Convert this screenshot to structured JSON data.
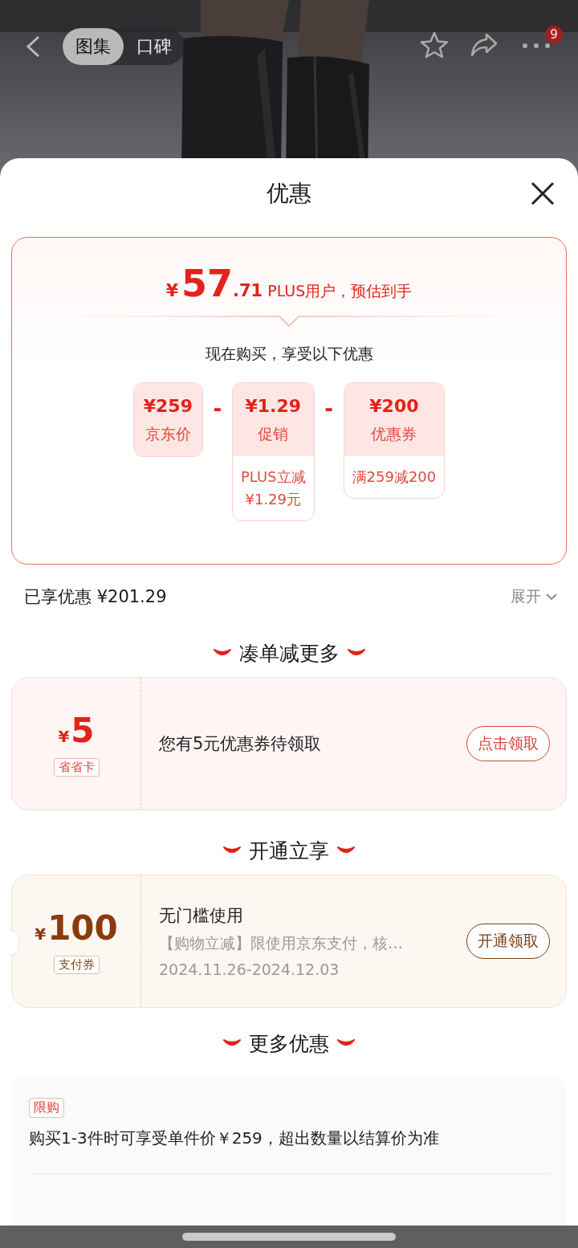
{
  "header": {
    "tabs": [
      {
        "label": "图集",
        "selected": true
      },
      {
        "label": "口碑",
        "selected": false
      }
    ],
    "badge": "9"
  },
  "sheet": {
    "title": "优惠",
    "estimate": {
      "currency": "¥",
      "integer": "57",
      "decimal": ".71",
      "caption": "PLUS用户，预估到手",
      "subtitle": "现在购买，享受以下优惠",
      "breakdown": [
        {
          "amount": "¥259",
          "label": "京东价"
        },
        {
          "operator": "-",
          "amount": "¥1.29",
          "label": "促销",
          "detail": [
            "PLUS立减",
            "¥1.29元"
          ]
        },
        {
          "operator": "-",
          "amount": "¥200",
          "label": "优惠券",
          "detail": [
            "满259减200"
          ]
        }
      ]
    },
    "saved": "已享优惠 ¥201.29",
    "expand": "展开",
    "sections": [
      {
        "heading": "凑单减更多",
        "coupon": {
          "kind": "red",
          "currency": "¥",
          "amount": "5",
          "tag": "省省卡",
          "title": "您有5元优惠券待领取",
          "button": "点击领取"
        }
      },
      {
        "heading": "开通立享",
        "coupon": {
          "kind": "gold",
          "currency": "¥",
          "amount": "100",
          "tag": "支付券",
          "title": "无门槛使用",
          "description": "【购物立减】限使用京东支付，核…",
          "dates": "2024.11.26-2024.12.03",
          "button": "开通领取"
        }
      }
    ],
    "more": {
      "heading": "更多优惠",
      "items": [
        {
          "tag": "限购",
          "text": "购买1-3件时可享受单件价￥259，超出数量以结算价为准"
        }
      ]
    }
  }
}
